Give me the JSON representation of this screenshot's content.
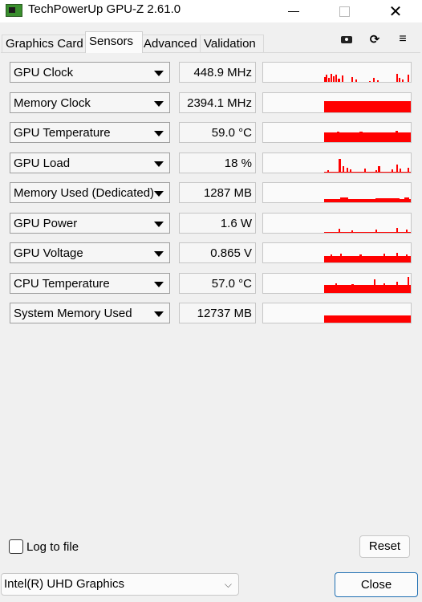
{
  "window": {
    "title": "TechPowerUp GPU-Z 2.61.0",
    "min_glyph": "—",
    "max_glyph": "☐",
    "close_glyph": "✕"
  },
  "tabs": [
    {
      "label": "Graphics Card",
      "active": false
    },
    {
      "label": "Sensors",
      "active": true
    },
    {
      "label": "Advanced",
      "active": false
    },
    {
      "label": "Validation",
      "active": false
    }
  ],
  "toolbar": {
    "screenshot_icon": "camera-icon",
    "refresh_icon": "refresh-icon",
    "menu_icon": "hamburger-menu-icon",
    "refresh_glyph": "⟳",
    "menu_glyph": "≡"
  },
  "colors": {
    "graph": "#ff0000",
    "close_button_border": "#1f6fb2"
  },
  "sensors": [
    {
      "name": "GPU Clock",
      "value": "448.9 MHz"
    },
    {
      "name": "Memory Clock",
      "value": "2394.1 MHz"
    },
    {
      "name": "GPU Temperature",
      "value": "59.0 °C"
    },
    {
      "name": "GPU Load",
      "value": "18 %"
    },
    {
      "name": "Memory Used (Dedicated)",
      "value": "1287 MB"
    },
    {
      "name": "GPU Power",
      "value": "1.6 W"
    },
    {
      "name": "GPU Voltage",
      "value": "0.865 V"
    },
    {
      "name": "CPU Temperature",
      "value": "57.0 °C"
    },
    {
      "name": "System Memory Used",
      "value": "12737 MB"
    }
  ],
  "bottom": {
    "log_to_file_label": "Log to file",
    "log_to_file_checked": false,
    "reset_label": "Reset",
    "gpu_selected": "Intel(R) UHD Graphics",
    "gpu_chevron": "⌵",
    "close_label": "Close"
  }
}
